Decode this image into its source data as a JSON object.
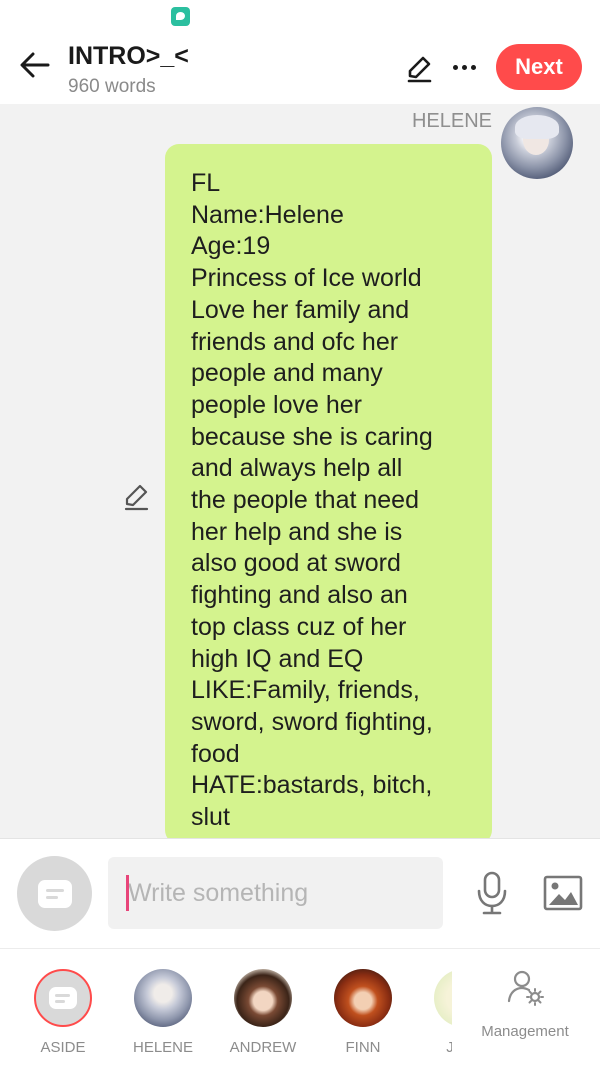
{
  "header": {
    "title": "INTRO>_<",
    "word_count": "960 words",
    "next_label": "Next",
    "accent_color": "#ff4b4b"
  },
  "chat": {
    "speaker_name": "HELENE",
    "message_text": "FL\nName:Helene\nAge:19\nPrincess of Ice world\nLove her family and\nfriends and ofc her\npeople and many\npeople love her\nbecause she is caring\nand always help all\nthe people that need\nher help and she is\nalso good at sword\nfighting and also an\ntop class cuz of her\nhigh IQ and EQ\nLIKE:Family, friends,\nsword, sword fighting,\nfood\nHATE:bastards, bitch,\nslut",
    "bubble_color": "#d4f38e"
  },
  "composer": {
    "placeholder": "Write something",
    "value": ""
  },
  "characters": [
    {
      "label": "ASIDE",
      "icon": "aside-icon",
      "selected": true
    },
    {
      "label": "HELENE",
      "icon": "avatar"
    },
    {
      "label": "ANDREW",
      "icon": "avatar"
    },
    {
      "label": "FINN",
      "icon": "avatar"
    },
    {
      "label": "J",
      "icon": "avatar"
    }
  ],
  "management_label": "Management",
  "icons": {
    "back": "arrow-left-icon",
    "edit": "pencil-icon",
    "more": "more-horizontal-icon",
    "mic": "microphone-icon",
    "image": "image-icon",
    "management": "user-gear-icon"
  }
}
